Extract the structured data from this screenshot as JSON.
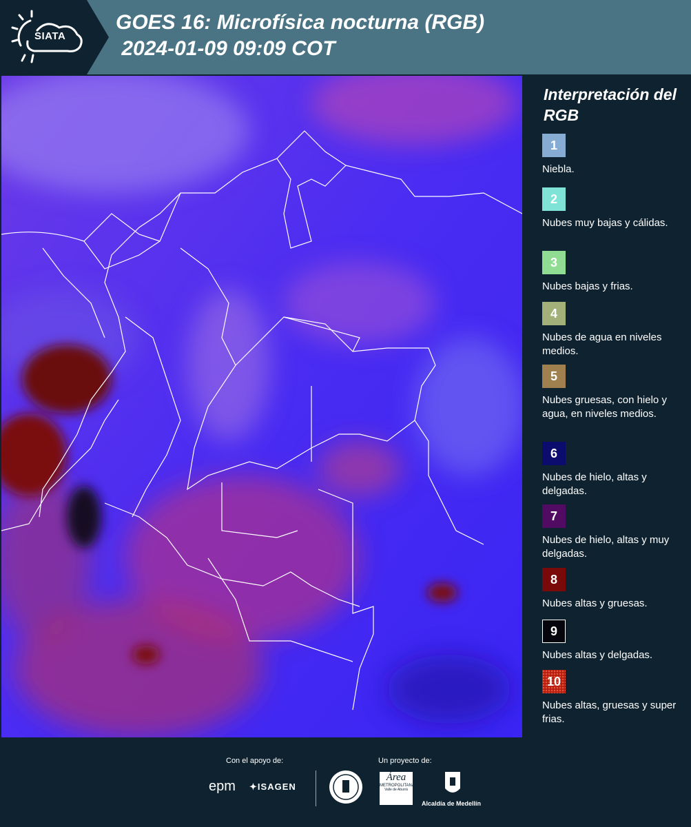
{
  "header": {
    "logo_text": "SIATA",
    "title_line1": "GOES 16: Microfísica nocturna (RGB)",
    "title_line2": " 2024-01-09 09:09 COT"
  },
  "legend": {
    "title": "Interpretación del RGB",
    "items": [
      {
        "number": "1",
        "color": "#87acd4",
        "description": "Niebla."
      },
      {
        "number": "2",
        "color": "#7fe3d8",
        "description": "Nubes muy bajas y cálidas."
      },
      {
        "number": "3",
        "color": "#8fdc92",
        "description": "Nubes bajas y frias."
      },
      {
        "number": "4",
        "color": "#a3b07a",
        "description": "Nubes de agua en niveles medios."
      },
      {
        "number": "5",
        "color": "#a0804e",
        "description": "Nubes gruesas, con hielo y agua, en niveles medios."
      },
      {
        "number": "6",
        "color": "#0c0c6e",
        "description": "Nubes de hielo, altas y delgadas."
      },
      {
        "number": "7",
        "color": "#520b62",
        "description": "Nubes de hielo, altas y muy delgadas."
      },
      {
        "number": "8",
        "color": "#7a0a0a",
        "description": "Nubes altas y gruesas."
      },
      {
        "number": "9",
        "color": "#05050d",
        "description": "Nubes altas y delgadas."
      },
      {
        "number": "10",
        "color": "#b81c10",
        "description": "Nubes altas, gruesas y super frias."
      }
    ]
  },
  "footer": {
    "support_label": "Con el apoyo de:",
    "project_label": "Un proyecto de:",
    "sponsor_1": "epm",
    "sponsor_2": "ISAGEN",
    "partner_2_line1": "Área",
    "partner_2_line2": "METROPOLITANA",
    "partner_2_line3": "Valle de Aburrá",
    "partner_3": "Alcaldía de Medellín"
  }
}
